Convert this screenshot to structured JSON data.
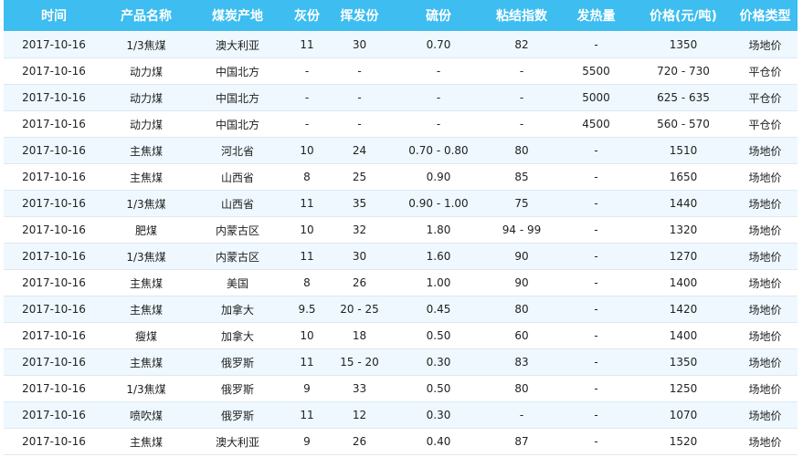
{
  "table": {
    "headers": [
      "时间",
      "产品名称",
      "煤炭产地",
      "灰份",
      "挥发份",
      "硫份",
      "粘结指数",
      "发热量",
      "价格(元/吨)",
      "价格类型"
    ],
    "rows": [
      [
        "2017-10-16",
        "1/3焦煤",
        "澳大利亚",
        "11",
        "30",
        "0.70",
        "82",
        "-",
        "1350",
        "场地价"
      ],
      [
        "2017-10-16",
        "动力煤",
        "中国北方",
        "-",
        "-",
        "-",
        "-",
        "5500",
        "720 - 730",
        "平仓价"
      ],
      [
        "2017-10-16",
        "动力煤",
        "中国北方",
        "-",
        "-",
        "-",
        "-",
        "5000",
        "625 - 635",
        "平仓价"
      ],
      [
        "2017-10-16",
        "动力煤",
        "中国北方",
        "-",
        "-",
        "-",
        "-",
        "4500",
        "560 - 570",
        "平仓价"
      ],
      [
        "2017-10-16",
        "主焦煤",
        "河北省",
        "10",
        "24",
        "0.70 - 0.80",
        "80",
        "-",
        "1510",
        "场地价"
      ],
      [
        "2017-10-16",
        "主焦煤",
        "山西省",
        "8",
        "25",
        "0.90",
        "85",
        "-",
        "1650",
        "场地价"
      ],
      [
        "2017-10-16",
        "1/3焦煤",
        "山西省",
        "11",
        "35",
        "0.90 - 1.00",
        "75",
        "-",
        "1440",
        "场地价"
      ],
      [
        "2017-10-16",
        "肥煤",
        "内蒙古区",
        "10",
        "32",
        "1.80",
        "94 - 99",
        "-",
        "1320",
        "场地价"
      ],
      [
        "2017-10-16",
        "1/3焦煤",
        "内蒙古区",
        "11",
        "30",
        "1.60",
        "90",
        "-",
        "1270",
        "场地价"
      ],
      [
        "2017-10-16",
        "主焦煤",
        "美国",
        "8",
        "26",
        "1.00",
        "90",
        "-",
        "1400",
        "场地价"
      ],
      [
        "2017-10-16",
        "主焦煤",
        "加拿大",
        "9.5",
        "20 - 25",
        "0.45",
        "80",
        "-",
        "1420",
        "场地价"
      ],
      [
        "2017-10-16",
        "瘦煤",
        "加拿大",
        "10",
        "18",
        "0.50",
        "60",
        "-",
        "1400",
        "场地价"
      ],
      [
        "2017-10-16",
        "主焦煤",
        "俄罗斯",
        "11",
        "15 - 20",
        "0.30",
        "83",
        "-",
        "1350",
        "场地价"
      ],
      [
        "2017-10-16",
        "1/3焦煤",
        "俄罗斯",
        "9",
        "33",
        "0.50",
        "80",
        "-",
        "1250",
        "场地价"
      ],
      [
        "2017-10-16",
        "喷吹煤",
        "俄罗斯",
        "11",
        "12",
        "0.30",
        "-",
        "-",
        "1070",
        "场地价"
      ],
      [
        "2017-10-16",
        "主焦煤",
        "澳大利亚",
        "9",
        "26",
        "0.40",
        "87",
        "-",
        "1520",
        "场地价"
      ]
    ]
  }
}
